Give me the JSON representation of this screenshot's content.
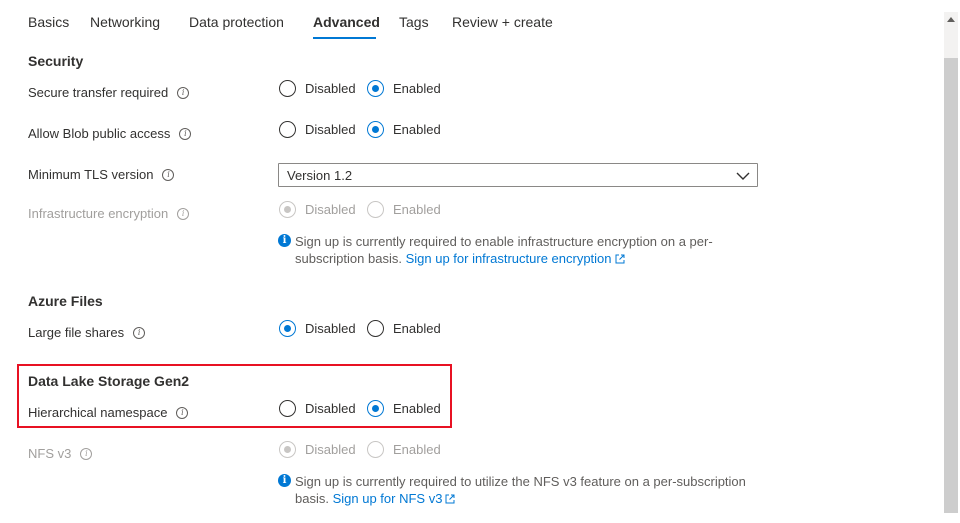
{
  "tabs": [
    {
      "label": "Basics"
    },
    {
      "label": "Networking"
    },
    {
      "label": "Data protection"
    },
    {
      "label": "Advanced"
    },
    {
      "label": "Tags"
    },
    {
      "label": "Review + create"
    }
  ],
  "active_tab": "Advanced",
  "accent_color": "#0078d4",
  "highlight_color": "#e81123",
  "security": {
    "title": "Security",
    "secure_transfer": {
      "label": "Secure transfer required",
      "options": [
        "Disabled",
        "Enabled"
      ],
      "selected": "Enabled"
    },
    "blob_public_access": {
      "label": "Allow Blob public access",
      "options": [
        "Disabled",
        "Enabled"
      ],
      "selected": "Enabled"
    },
    "min_tls": {
      "label": "Minimum TLS version",
      "value": "Version 1.2"
    },
    "infra_encryption": {
      "label": "Infrastructure encryption",
      "options": [
        "Disabled",
        "Enabled"
      ],
      "selected": "Disabled",
      "disabled": true,
      "note": "Sign up is currently required to enable infrastructure encryption on a per-subscription basis.",
      "link": "Sign up for infrastructure encryption"
    }
  },
  "azure_files": {
    "title": "Azure Files",
    "large_file_shares": {
      "label": "Large file shares",
      "options": [
        "Disabled",
        "Enabled"
      ],
      "selected": "Disabled"
    }
  },
  "data_lake": {
    "title": "Data Lake Storage Gen2",
    "hierarchical_namespace": {
      "label": "Hierarchical namespace",
      "options": [
        "Disabled",
        "Enabled"
      ],
      "selected": "Enabled"
    }
  },
  "nfs": {
    "label": "NFS v3",
    "options": [
      "Disabled",
      "Enabled"
    ],
    "selected": "Disabled",
    "disabled": true,
    "note": "Sign up is currently required to utilize the NFS v3 feature on a per-subscription basis.",
    "link": "Sign up for NFS v3"
  }
}
